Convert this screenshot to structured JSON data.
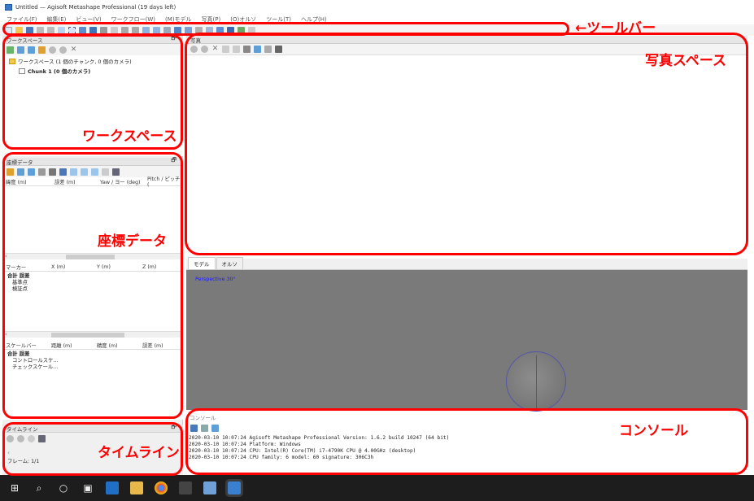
{
  "window": {
    "title": "Untitled — Agisoft Metashape Professional (19 days left)"
  },
  "menu": [
    "ファイル(F)",
    "編集(E)",
    "ビュー(V)",
    "ワークフロー(W)",
    "(M)モデル",
    "写真(P)",
    "(O)オルソ",
    "ツール(T)",
    "ヘルプ(H)"
  ],
  "workspace": {
    "header": "ワークスペース",
    "tree_root": "ワークスペース (1 個のチャンク, 0 個のカメラ)",
    "chunk": "Chunk 1 (0 個のカメラ)"
  },
  "reference": {
    "header": "座標データ",
    "columns": [
      "緯度 (m)",
      "誤差 (m)",
      "Yaw / ヨー (deg)",
      "Pitch / ピッチ ("
    ],
    "marker_columns": [
      "マーカー",
      "X (m)",
      "Y (m)",
      "Z (m)"
    ],
    "marker_rows": [
      "合計 誤差",
      "基準点",
      "検証点"
    ],
    "scalebar_columns": [
      "スケールバー",
      "距離 (m)",
      "精度 (m)",
      "誤差 (m)"
    ],
    "scalebar_rows": [
      "合計 誤差",
      "コントロールスケ...",
      "チェックスケール..."
    ]
  },
  "photos": {
    "header": "写真"
  },
  "model_view": {
    "tabs": [
      "モデル",
      "オルソ"
    ],
    "perspective_label": "Perspective 30°"
  },
  "console": {
    "header": "コンソール",
    "lines": [
      "2020-03-10 10:07:24 Agisoft Metashape Professional Version: 1.6.2 build 10247 (64 bit)",
      "2020-03-10 10:07:24 Platform: Windows",
      "2020-03-10 10:07:24 CPU: Intel(R) Core(TM) i7-4790K CPU @ 4.00GHz (desktop)",
      "2020-03-10 10:07:24 CPU family: 6 model: 60 signature: 306C3h"
    ]
  },
  "timeline": {
    "header": "タイムライン",
    "frame": "フレーム: 1/1"
  },
  "annotations": {
    "toolbar": "←ツールバー",
    "photo_space": "写真スペース",
    "workspace": "ワークスペース",
    "reference": "座標データ",
    "console": "コンソール",
    "timeline": "タイムライン"
  },
  "colors": {
    "annotation": "#ff0000",
    "view_bg": "#7a7a7a",
    "taskbar": "#1d1d1d"
  }
}
